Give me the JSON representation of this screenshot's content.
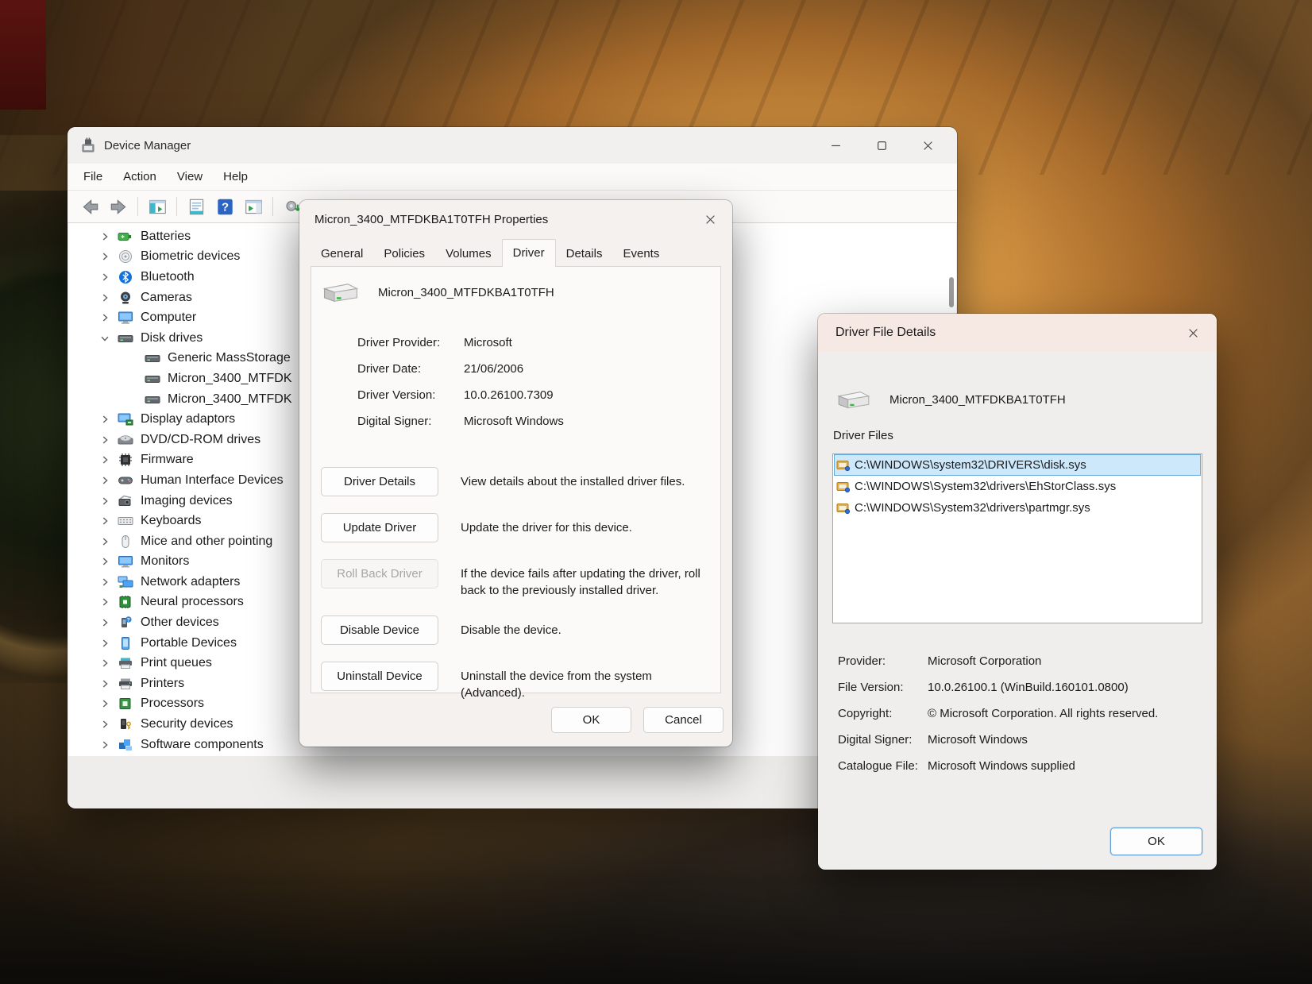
{
  "device_manager": {
    "title": "Device Manager",
    "menu": [
      "File",
      "Action",
      "View",
      "Help"
    ],
    "toolbar": [
      "back",
      "forward",
      "sep",
      "console-tree",
      "sep",
      "properties",
      "help",
      "action-pane",
      "sep",
      "scan"
    ],
    "tree": {
      "items": [
        {
          "label": "Batteries",
          "icon": "battery",
          "level": 0
        },
        {
          "label": "Biometric devices",
          "icon": "fingerprint",
          "level": 0
        },
        {
          "label": "Bluetooth",
          "icon": "bluetooth",
          "level": 0
        },
        {
          "label": "Cameras",
          "icon": "camera",
          "level": 0
        },
        {
          "label": "Computer",
          "icon": "computer",
          "level": 0
        },
        {
          "label": "Disk drives",
          "icon": "disk",
          "level": 0,
          "expanded": true
        },
        {
          "label": "Generic MassStorage",
          "icon": "disk",
          "level": 1
        },
        {
          "label": "Micron_3400_MTFDK",
          "icon": "disk",
          "level": 1
        },
        {
          "label": "Micron_3400_MTFDK",
          "icon": "disk",
          "level": 1
        },
        {
          "label": "Display adaptors",
          "icon": "display",
          "level": 0
        },
        {
          "label": "DVD/CD-ROM drives",
          "icon": "dvd",
          "level": 0
        },
        {
          "label": "Firmware",
          "icon": "firmware",
          "level": 0
        },
        {
          "label": "Human Interface Devices",
          "icon": "hid",
          "level": 0
        },
        {
          "label": "Imaging devices",
          "icon": "imaging",
          "level": 0
        },
        {
          "label": "Keyboards",
          "icon": "keyboard",
          "level": 0
        },
        {
          "label": "Mice and other pointing",
          "icon": "mouse",
          "level": 0
        },
        {
          "label": "Monitors",
          "icon": "monitor",
          "level": 0
        },
        {
          "label": "Network adapters",
          "icon": "network",
          "level": 0
        },
        {
          "label": "Neural processors",
          "icon": "neural",
          "level": 0
        },
        {
          "label": "Other devices",
          "icon": "other",
          "level": 0
        },
        {
          "label": "Portable Devices",
          "icon": "portable",
          "level": 0
        },
        {
          "label": "Print queues",
          "icon": "printqueue",
          "level": 0
        },
        {
          "label": "Printers",
          "icon": "printer",
          "level": 0
        },
        {
          "label": "Processors",
          "icon": "processor",
          "level": 0
        },
        {
          "label": "Security devices",
          "icon": "security",
          "level": 0
        },
        {
          "label": "Software components",
          "icon": "software",
          "level": 0
        }
      ]
    }
  },
  "properties_dialog": {
    "title": "Micron_3400_MTFDKBA1T0TFH Properties",
    "tabs": [
      {
        "label": "General"
      },
      {
        "label": "Policies"
      },
      {
        "label": "Volumes"
      },
      {
        "label": "Driver",
        "active": true
      },
      {
        "label": "Details"
      },
      {
        "label": "Events"
      }
    ],
    "device_name": "Micron_3400_MTFDKBA1T0TFH",
    "info": [
      {
        "label": "Driver Provider:",
        "value": "Microsoft"
      },
      {
        "label": "Driver Date:",
        "value": "21/06/2006"
      },
      {
        "label": "Driver Version:",
        "value": "10.0.26100.7309"
      },
      {
        "label": "Digital Signer:",
        "value": "Microsoft Windows"
      }
    ],
    "actions": [
      {
        "button": "Driver Details",
        "desc": "View details about the installed driver files.",
        "disabled": false
      },
      {
        "button": "Update Driver",
        "desc": "Update the driver for this device.",
        "disabled": false
      },
      {
        "button": "Roll Back Driver",
        "desc": "If the device fails after updating the driver, roll back to the previously installed driver.",
        "disabled": true
      },
      {
        "button": "Disable Device",
        "desc": "Disable the device.",
        "disabled": false
      },
      {
        "button": "Uninstall Device",
        "desc": "Uninstall the device from the system (Advanced).",
        "disabled": false
      }
    ],
    "ok_label": "OK",
    "cancel_label": "Cancel"
  },
  "driver_file_details": {
    "title": "Driver File Details",
    "device_name": "Micron_3400_MTFDKBA1T0TFH",
    "files_label": "Driver Files",
    "selected_index": 0,
    "files": [
      "C:\\WINDOWS\\system32\\DRIVERS\\disk.sys",
      "C:\\WINDOWS\\System32\\drivers\\EhStorClass.sys",
      "C:\\WINDOWS\\System32\\drivers\\partmgr.sys"
    ],
    "fields": [
      {
        "label": "Provider:",
        "value": "Microsoft Corporation"
      },
      {
        "label": "File Version:",
        "value": "10.0.26100.1 (WinBuild.160101.0800)"
      },
      {
        "label": "Copyright:",
        "value": "© Microsoft Corporation. All rights reserved."
      },
      {
        "label": "Digital Signer:",
        "value": "Microsoft Windows"
      },
      {
        "label": "Catalogue File:",
        "value": "Microsoft Windows supplied"
      }
    ],
    "ok_label": "OK"
  },
  "colors": {
    "selection_bg": "#cde8fb",
    "selection_border": "#66a9dd",
    "details_titlebar": "#f6e9e3",
    "window_bg": "#eeedeb"
  }
}
